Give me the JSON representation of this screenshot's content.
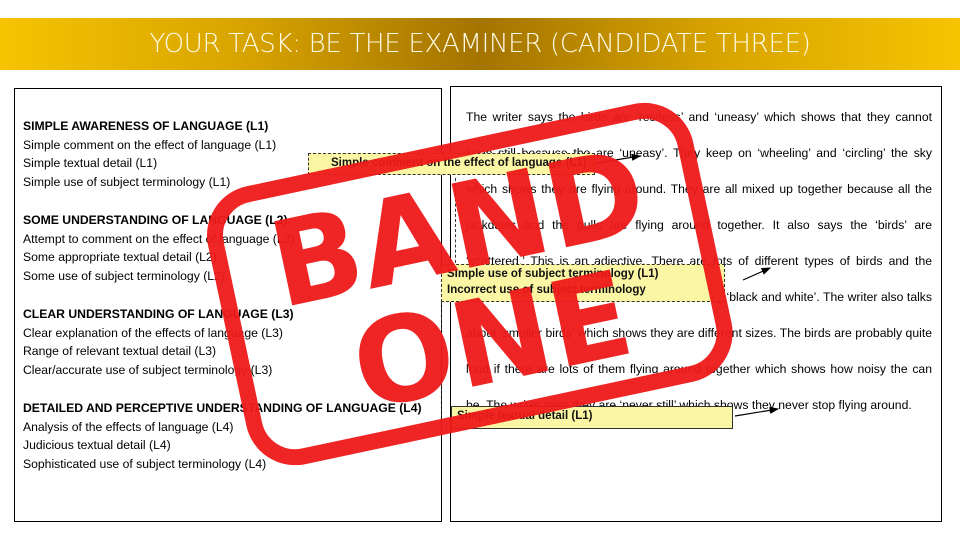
{
  "header": {
    "title": "YOUR TASK: BE THE EXAMINER (CANDIDATE THREE)"
  },
  "colors": {
    "title_bar": "#d8a400",
    "stamp": "#ef1a1a",
    "annotation_bg": "#fbf6a3"
  },
  "criteria": [
    {
      "heading": "SIMPLE AWARENESS OF LANGUAGE (L1)",
      "items": [
        "Simple comment on the effect of language (L1)",
        "Simple textual detail (L1)",
        "Simple use of subject terminology (L1)"
      ]
    },
    {
      "heading": "SOME UNDERSTANDING OF LANGUAGE (L2)",
      "items": [
        "Attempt to comment on the effect of language (L2)",
        "Some appropriate textual detail (L2)",
        "Some use of subject terminology (L2)"
      ]
    },
    {
      "heading": "CLEAR UNDERSTANDING OF LANGUAGE (L3)",
      "items": [
        "Clear explanation of the effects of language (L3)",
        "Range of relevant textual detail (L3)",
        "Clear/accurate use of subject terminology (L3)"
      ]
    },
    {
      "heading": "DETAILED AND PERCEPTIVE UNDERSTANDING OF LANGUAGE (L4)",
      "items": [
        "Analysis of the effects of language (L4)",
        "Judicious textual detail (L4)",
        "Sophisticated use of subject terminology (L4)"
      ]
    }
  ],
  "essay": {
    "text": "The writer says the birds are ‘restless’ and ‘uneasy’ which shows that they cannot keep still because the are ‘uneasy’. They keep on ‘wheeling’ and ‘circling’ the sky which shows they are flying around. They are all mixed up together because all the jackdaws and the gulls are flying around together. It also says the ‘birds’ are ‘scattered.’ This is an adjective. There are lots of different types of birds and the colours of the birds are also described as being ‘black and white’. The writer also talks about ‘smaller birds’ which shows they are different sizes. The birds are probably quite loud if there are lots of them flying around together which shows how noisy the can be. The writer says they are ‘never still’ which shows they never stop flying around."
  },
  "annotations": [
    {
      "lines": [
        "Simple comment on the effect of language (L1)"
      ]
    },
    {
      "lines": [
        "Simple use of subject terminology (L1)",
        "Incorrect use of subject terminology"
      ]
    },
    {
      "lines": [
        "Simple textual detail (L1)"
      ]
    }
  ],
  "stamp": {
    "line1": "BAND",
    "line2": "ONE"
  }
}
